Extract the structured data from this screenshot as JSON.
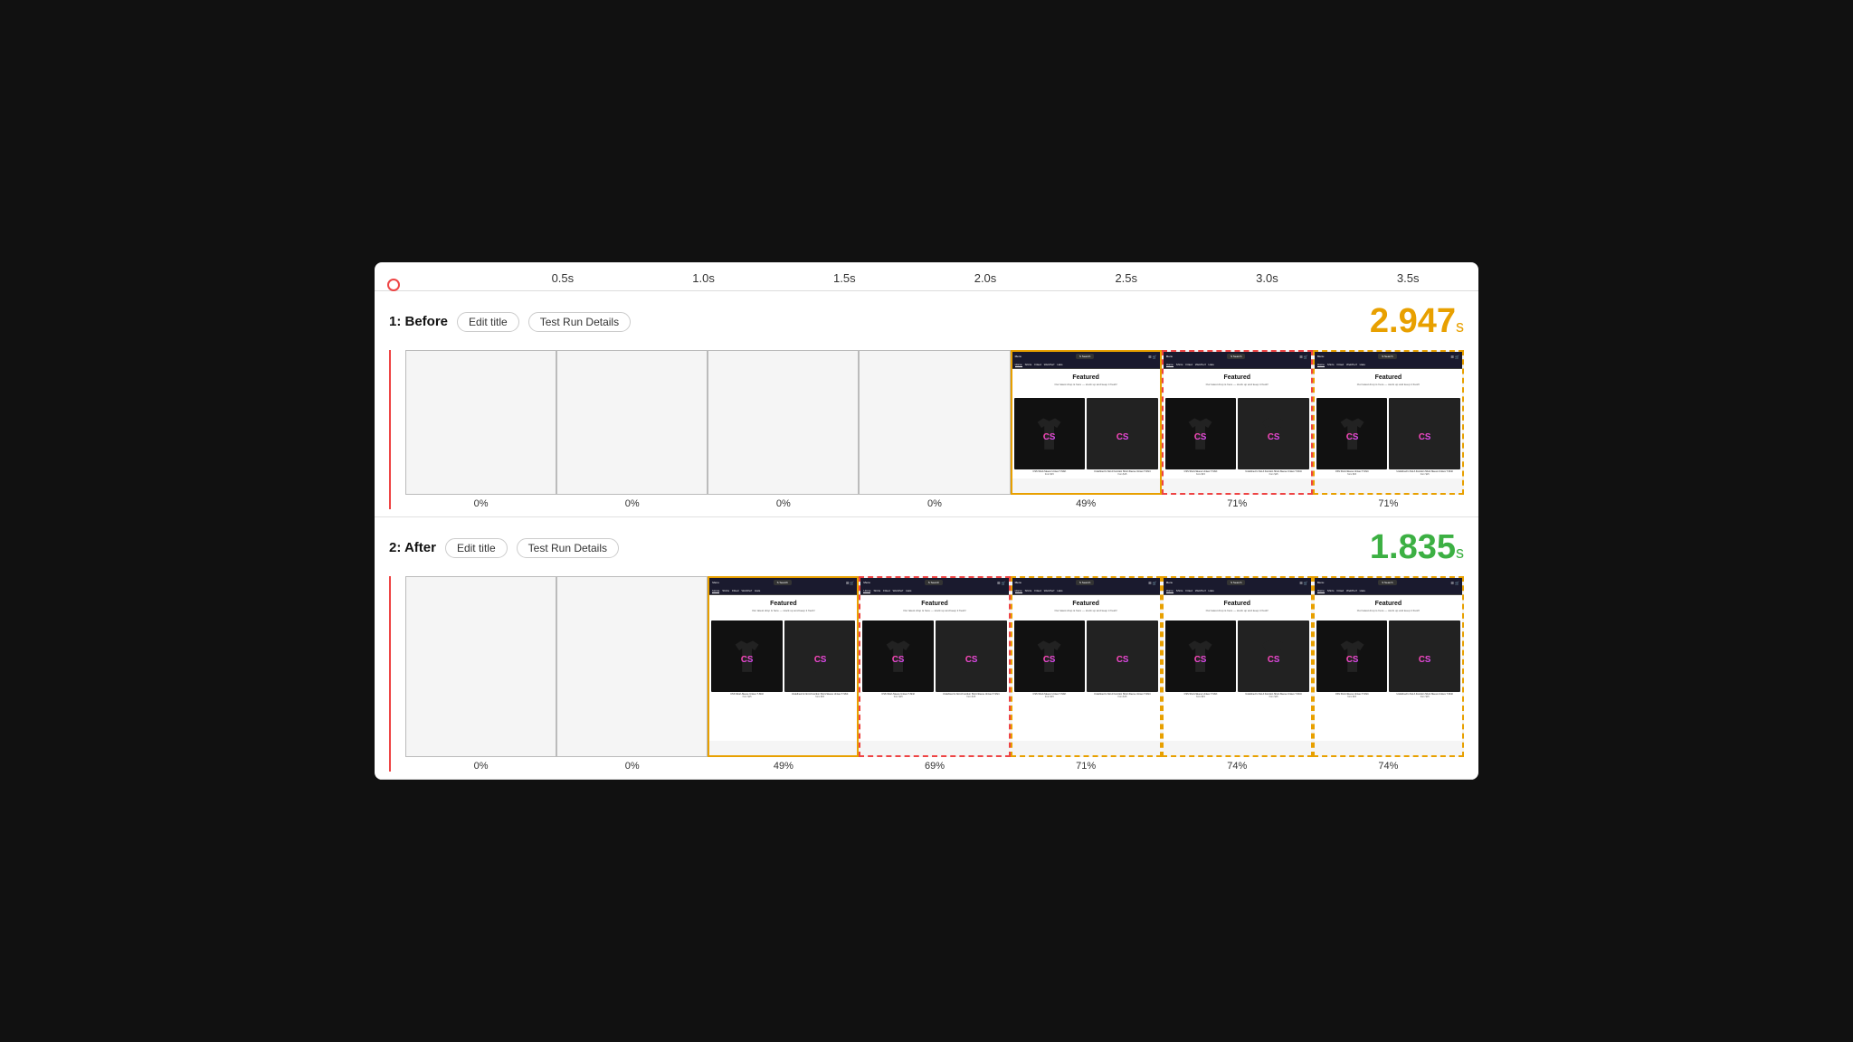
{
  "timeline": {
    "ticks": [
      "0.5s",
      "1.0s",
      "1.5s",
      "2.0s",
      "2.5s",
      "3.0s",
      "3.5s"
    ]
  },
  "section1": {
    "label": "1: Before",
    "edit_btn": "Edit title",
    "test_btn": "Test Run Details",
    "score": "2.947",
    "score_unit": "s",
    "score_color": "orange",
    "frames": [
      {
        "pct": "0%",
        "type": "empty"
      },
      {
        "pct": "0%",
        "type": "empty"
      },
      {
        "pct": "0%",
        "type": "empty"
      },
      {
        "pct": "0%",
        "type": "empty"
      },
      {
        "pct": "49%",
        "type": "highlight-orange",
        "has_content": true
      },
      {
        "pct": "71%",
        "type": "highlight-red-dashed",
        "has_content": true
      },
      {
        "pct": "71%",
        "type": "highlight-orange-dashed",
        "has_content": true
      }
    ]
  },
  "section2": {
    "label": "2: After",
    "edit_btn": "Edit title",
    "test_btn": "Test Run Details",
    "score": "1.835",
    "score_unit": "s",
    "score_color": "green",
    "frames": [
      {
        "pct": "0%",
        "type": "empty"
      },
      {
        "pct": "0%",
        "type": "empty"
      },
      {
        "pct": "49%",
        "type": "highlight-orange",
        "has_content": true
      },
      {
        "pct": "69%",
        "type": "highlight-red-dashed",
        "has_content": true
      },
      {
        "pct": "71%",
        "type": "highlight-orange-dashed",
        "has_content": true
      },
      {
        "pct": "74%",
        "type": "highlight-orange-dashed",
        "has_content": true
      },
      {
        "pct": "74%",
        "type": "highlight-orange-dashed",
        "has_content": true
      }
    ]
  },
  "nav": {
    "menu": "Menu",
    "search": "Search",
    "links": [
      "Home",
      "Shirts",
      "Fitted",
      "WebPerf",
      "Hats"
    ],
    "hero_title": "Featured",
    "hero_sub": "Our latest drop is here — stock up and keep it fresh!",
    "products": [
      {
        "title": "CSS Short-Sleeve Unisex T-Shirt",
        "price": "from $15"
      },
      {
        "title": "Undefined Is Not A Function Short-Sleeve Unisex T-Shirt",
        "price": "from $15"
      }
    ]
  }
}
